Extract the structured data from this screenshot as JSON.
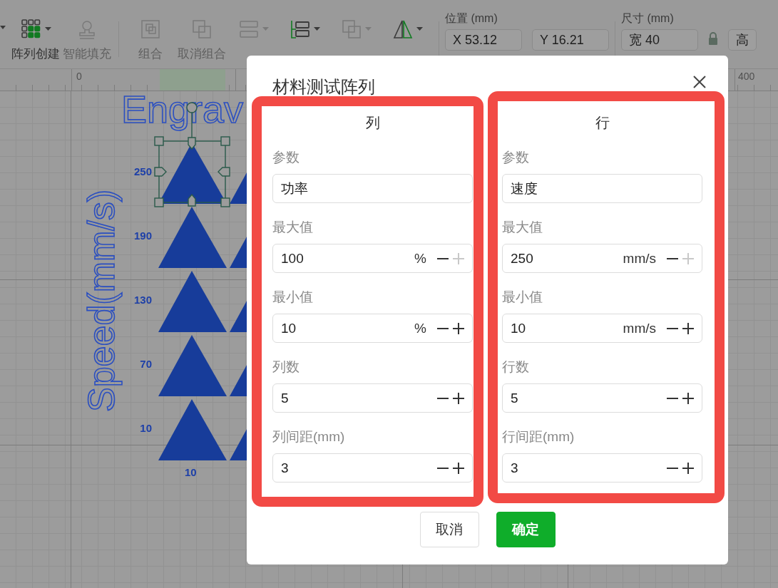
{
  "toolbar": {
    "items": [
      {
        "kind": "grid",
        "label": "阵列创建",
        "disabled": false,
        "dropdown": true
      },
      {
        "kind": "stamp",
        "label": "智能填充",
        "disabled": true,
        "dropdown": false
      },
      {
        "kind": "group",
        "label": "组合",
        "disabled": true,
        "dropdown": false
      },
      {
        "kind": "ungroup",
        "label": "取消组合",
        "disabled": true,
        "dropdown": false
      },
      {
        "kind": "align",
        "disabled": true,
        "dropdown": true
      },
      {
        "kind": "arrange",
        "disabled": false,
        "dropdown": true
      },
      {
        "kind": "merge",
        "disabled": true,
        "dropdown": true
      },
      {
        "kind": "flip",
        "disabled": false,
        "dropdown": true
      }
    ],
    "position": {
      "label": "位置 (mm)",
      "x": "X 53.12",
      "y": "Y 16.21"
    },
    "size": {
      "label": "尺寸 (mm)",
      "width": "宽 40",
      "height": "高"
    }
  },
  "ruler": {
    "labels": [
      "0",
      "400"
    ]
  },
  "canvas": {
    "title": "Engrav",
    "axis_label": "Speed(mm/s)",
    "row_labels": [
      "250",
      "190",
      "130",
      "70",
      "10"
    ],
    "column_labels": [
      "10"
    ]
  },
  "dialog": {
    "title": "材料测试阵列",
    "columns": [
      {
        "heading": "列",
        "fields": [
          {
            "kind": "text",
            "label": "参数",
            "value": "功率"
          },
          {
            "kind": "number",
            "label": "最大值",
            "value": "100",
            "unit": "%",
            "plus_disabled": true
          },
          {
            "kind": "number",
            "label": "最小值",
            "value": "10",
            "unit": "%",
            "plus_disabled": false
          },
          {
            "kind": "number",
            "label": "列数",
            "value": "5",
            "plus_disabled": false
          },
          {
            "kind": "number",
            "label": "列间距(mm)",
            "value": "3",
            "plus_disabled": false
          }
        ]
      },
      {
        "heading": "行",
        "fields": [
          {
            "kind": "text",
            "label": "参数",
            "value": "速度"
          },
          {
            "kind": "number",
            "label": "最大值",
            "value": "250",
            "unit": "mm/s",
            "plus_disabled": true
          },
          {
            "kind": "number",
            "label": "最小值",
            "value": "10",
            "unit": "mm/s",
            "plus_disabled": false
          },
          {
            "kind": "number",
            "label": "行数",
            "value": "5",
            "plus_disabled": false
          },
          {
            "kind": "number",
            "label": "行间距(mm)",
            "value": "3",
            "plus_disabled": false
          }
        ]
      }
    ],
    "buttons": [
      {
        "label": "取消",
        "primary": false
      },
      {
        "label": "确定",
        "primary": true
      }
    ]
  }
}
